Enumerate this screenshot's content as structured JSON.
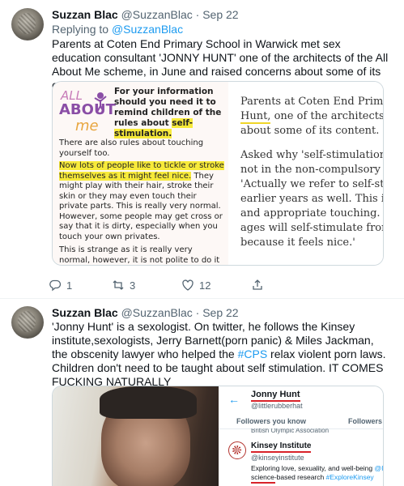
{
  "tweet1": {
    "author_name": "Suzzan Blac",
    "author_handle": "@SuzzanBlac",
    "separator": "·",
    "date": "Sep 22",
    "replying_prefix": "Replying to ",
    "replying_to": "@SuzzanBlac",
    "text": "Parents at Coten End Primary School in Warwick met sex education consultant 'JONNY HUNT' one of the architects of the All About Me scheme, in June and raised concerns about some of its content.",
    "media": {
      "leaflet": {
        "logo_all": "ALL",
        "logo_about": "ABOUT",
        "logo_me": "me",
        "box_title_a": "For your information should you need it to remind children of the rules about ",
        "box_title_b": "self-stimulation.",
        "para1": "There are also rules about touching yourself too.",
        "para2_highlight": "Now lots of people like to tickle or stroke themselves as it might feel nice.",
        "para2_rest": " They might play with their hair, stroke their skin or they may even touch their private parts. This is really very normal. However, some people may get cross or say that it is dirty, especially when you touch your own privates.",
        "para3": "This is strange as it is really very normal, however, it is not polite to do it when other"
      },
      "article": {
        "line1": "Parents at Coten End Primary",
        "line2_underlined": "Hunt,",
        "line2_rest": " one of the architects of",
        "line3": "about some of its content.",
        "line4": "Asked why 'self-stimulation' a",
        "line5": "not in the non-compulsory se",
        "line6": "'Actually we refer to self-stimu",
        "line7": "earlier years as well. This is no",
        "line8": "and appropriate touching. Ho",
        "line9": "ages will self-stimulate from t",
        "line10": "because it feels nice.'"
      }
    },
    "actions": {
      "replies": "1",
      "retweets": "3",
      "likes": "12"
    }
  },
  "tweet2": {
    "author_name": "Suzzan Blac",
    "author_handle": "@SuzzanBlac",
    "separator": "·",
    "date": "Sep 22",
    "text_a": "'Jonny Hunt' is a sexologist. On twitter, he follows the Kinsey institute,sexologists, Jerry Barnett(porn panic) & Miles Jackman, the obscenity lawyer who helped the ",
    "text_hashtag": "#CPS",
    "text_b": " relax violent porn laws. Children don't need to be taught about self stimulation. IT COMES FUCKING NATURALLY",
    "media": {
      "profile_back": "←",
      "profile_name": "Jonny Hunt",
      "profile_handle": "@littlerubberhat",
      "tab_followers_you_know": "Followers you know",
      "tab_followers": "Followers",
      "cut_text": "British Olympic Association",
      "kinsey_name": "Kinsey Institute",
      "kinsey_handle": "@kinseyinstitute",
      "kinsey_bio_a": "Exploring love, sexuality, and well-being ",
      "kinsey_bio_tag1": "@Ind",
      "kinsey_bio_b": "science-based research ",
      "kinsey_bio_tag2": "#ExploreKinsey"
    }
  },
  "colors": {
    "link": "#1d9bf0",
    "muted": "#536471",
    "highlight": "#f7ea3a",
    "annotation_red": "#d8232a"
  }
}
